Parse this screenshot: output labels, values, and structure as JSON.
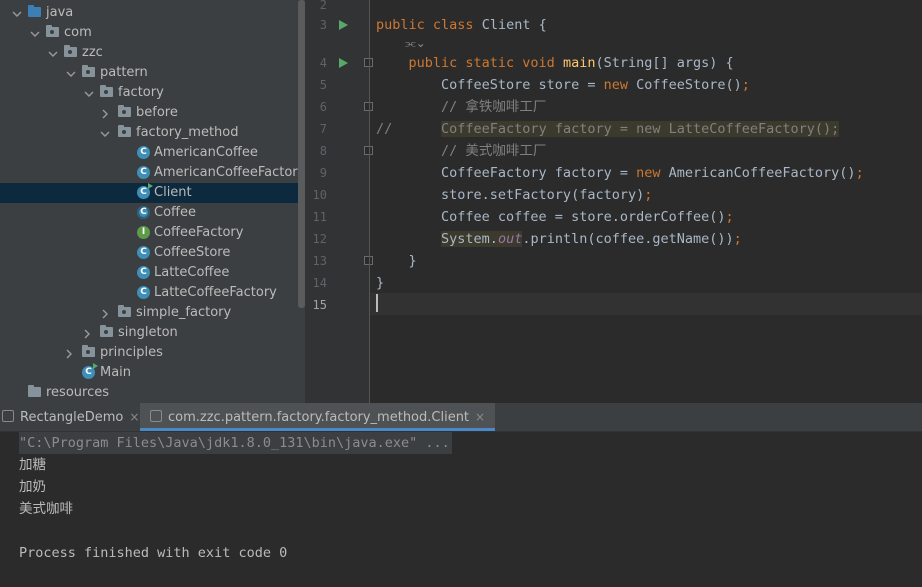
{
  "project_tree": {
    "items": [
      {
        "label": "java",
        "kind": "folder-blue"
      },
      {
        "label": "com",
        "kind": "package"
      },
      {
        "label": "zzc",
        "kind": "package"
      },
      {
        "label": "pattern",
        "kind": "package"
      },
      {
        "label": "factory",
        "kind": "package"
      },
      {
        "label": "before",
        "kind": "package"
      },
      {
        "label": "factory_method",
        "kind": "package"
      },
      {
        "label": "AmericanCoffee",
        "kind": "class"
      },
      {
        "label": "AmericanCoffeeFactory",
        "kind": "class"
      },
      {
        "label": "Client",
        "kind": "class-main",
        "selected": true
      },
      {
        "label": "Coffee",
        "kind": "abstract-class"
      },
      {
        "label": "CoffeeFactory",
        "kind": "interface"
      },
      {
        "label": "CoffeeStore",
        "kind": "class"
      },
      {
        "label": "LatteCoffee",
        "kind": "class"
      },
      {
        "label": "LatteCoffeeFactory",
        "kind": "class"
      },
      {
        "label": "simple_factory",
        "kind": "package"
      },
      {
        "label": "singleton",
        "kind": "package"
      },
      {
        "label": "principles",
        "kind": "package"
      },
      {
        "label": "Main",
        "kind": "class-main"
      },
      {
        "label": "resources",
        "kind": "folder-resources"
      }
    ]
  },
  "editor": {
    "line_numbers": [
      "2",
      "3",
      "4",
      "5",
      "6",
      "7",
      "8",
      "9",
      "10",
      "11",
      "12",
      "13",
      "14",
      "15"
    ],
    "current_line": "15",
    "hint_glyph": "⫘⌄",
    "code": {
      "l3a": "public",
      "l3b": " ",
      "l3c": "class",
      "l3d": " Client {",
      "l4a": "    ",
      "l4b": "public static void",
      "l4c": " ",
      "l4d": "main",
      "l4e": "(String[] args) {",
      "l5a": "        CoffeeStore store = ",
      "l5b": "new",
      "l5c": " CoffeeStore()",
      "l5d": ";",
      "l6": "        // 拿铁咖啡工厂",
      "l7a": "//      ",
      "l7b": "CoffeeFactory factory = new LatteCoffeeFactory();",
      "l8": "        // 美式咖啡工厂",
      "l9a": "        CoffeeFactory factory = ",
      "l9b": "new",
      "l9c": " AmericanCoffeeFactory()",
      "l9d": ";",
      "l10a": "        store.setFactory(factory)",
      "l10b": ";",
      "l11a": "        Coffee coffee = store.orderCoffee()",
      "l11b": ";",
      "l12a": "        ",
      "l12b": "System.",
      "l12c": "out",
      "l12d": ".println(coffee.getName())",
      "l12e": ";",
      "l13": "    }",
      "l14": "}"
    }
  },
  "run_tabs": [
    {
      "label": "RectangleDemo",
      "close": "×"
    },
    {
      "label": "com.zzc.pattern.factory.factory_method.Client",
      "close": "×",
      "active": true
    }
  ],
  "console": {
    "command": "\"C:\\Program Files\\Java\\jdk1.8.0_131\\bin\\java.exe\" ...",
    "lines": [
      "加糖",
      "加奶",
      "美式咖啡"
    ],
    "exit": "Process finished with exit code 0"
  }
}
